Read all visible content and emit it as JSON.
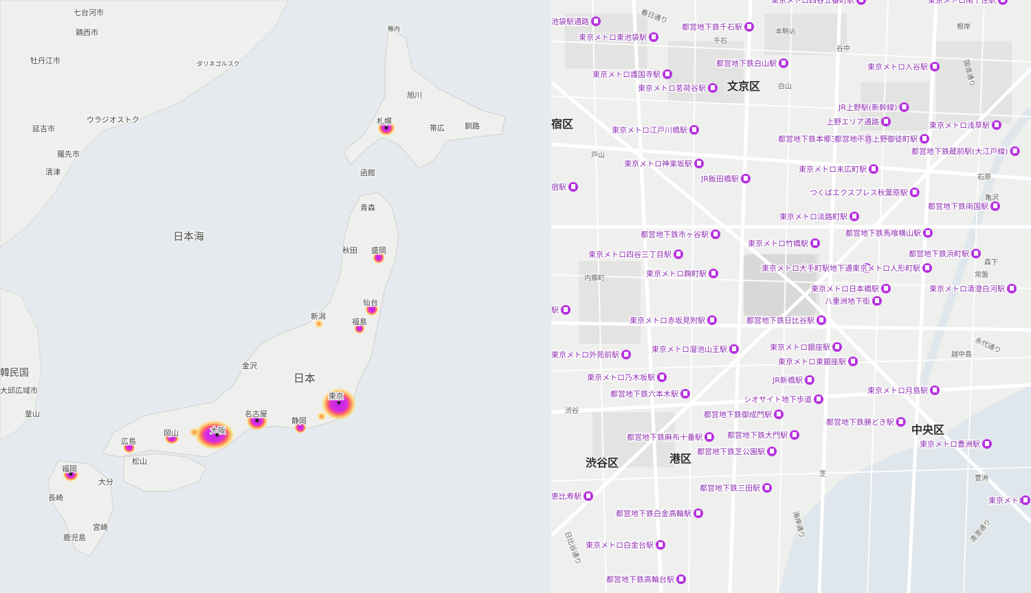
{
  "left_map": {
    "sea_labels": [
      "日本海"
    ],
    "country_labels": [
      "日本",
      "韓民国"
    ],
    "foreign_cities": [
      "七台河市",
      "鶏西市",
      "牡丹江市",
      "ダリネゴルスク",
      "ウラジオストク",
      "延吉市",
      "羅先市",
      "清津",
      "大邱広域市",
      "釜山"
    ],
    "cities": [
      "稚内",
      "旭川",
      "札幌",
      "帯広",
      "釧路",
      "函館",
      "青森",
      "秋田",
      "盛岡",
      "仙台",
      "新潟",
      "福島",
      "金沢",
      "名古屋",
      "静岡",
      "東京",
      "大阪",
      "岡山",
      "広島",
      "松山",
      "福岡",
      "大分",
      "長崎",
      "宮崎",
      "鹿児島"
    ],
    "hotspots": [
      {
        "city": "東京",
        "intensity": 1.0
      },
      {
        "city": "大阪",
        "intensity": 0.95
      },
      {
        "city": "名古屋",
        "intensity": 0.7
      },
      {
        "city": "札幌",
        "intensity": 0.6
      },
      {
        "city": "福岡",
        "intensity": 0.55
      },
      {
        "city": "仙台",
        "intensity": 0.5
      },
      {
        "city": "広島",
        "intensity": 0.45
      },
      {
        "city": "岡山",
        "intensity": 0.45
      },
      {
        "city": "静岡",
        "intensity": 0.4
      },
      {
        "city": "盛岡",
        "intensity": 0.35
      },
      {
        "city": "福島",
        "intensity": 0.35
      },
      {
        "city": "新潟",
        "intensity": 0.25
      }
    ]
  },
  "right_map": {
    "wards": [
      "文京区",
      "宿区",
      "渋谷区",
      "港区",
      "中央区"
    ],
    "areas": [
      "本駒込",
      "千石",
      "谷中",
      "白山",
      "根岸",
      "戸山",
      "石原",
      "亀沢",
      "森下",
      "内藤町",
      "常盤",
      "越中島",
      "渋谷",
      "豊洲",
      "芝"
    ],
    "roads": [
      "春日通り",
      "国道通り",
      "永代通り",
      "海岸通り",
      "清澄通り",
      "日比谷通り"
    ],
    "stations": [
      "東京メトロ四谷五番町駅",
      "東京メトロ南千住駅",
      "池袋駅通路",
      "都営地下鉄千石駅",
      "東京メトロ東池袋駅",
      "都営地下鉄白山駅",
      "東京メトロ入谷駅",
      "東京メトロ護国寺駅",
      "東京メトロ茗荷谷駅",
      "JR上野駅(新幹線)",
      "上野エリア通路",
      "東京メトロ浅草駅",
      "東京メトロ江戸川橋駅",
      "都営地下鉄本郷三丁目駅",
      "都営地下鉄上野御徒町駅",
      "都営地下鉄蔵前駅(大江戸線)",
      "東京メトロ神楽坂駅",
      "東京メトロ末広町駅",
      "JR飯田橋駅",
      "宿駅",
      "つくばエクスプレス秋葉原駅",
      "都営地下鉄両国駅",
      "東京メトロ淡路町駅",
      "都営地下鉄市ヶ谷駅",
      "都営地下鉄馬喰横山駅",
      "東京メトロ竹橋駅",
      "都営地下鉄浜町駅",
      "東京メトロ四谷三丁目駅",
      "東京メトロ大手町駅地下通路",
      "東京メトロ人形町駅",
      "東京メトロ麹町駅",
      "東京メトロ日本橋駅",
      "東京メトロ清澄白河駅",
      "八重洲地下街",
      "駅",
      "東京メトロ赤坂見附駅",
      "都営地下鉄日比谷駅",
      "東京メトロ溜池山王駅",
      "東京メトロ銀座駅",
      "東京メトロ外苑前駅",
      "東京メトロ東銀座駅",
      "東京メトロ乃木坂駅",
      "JR新橋駅",
      "都営地下鉄六本木駅",
      "シオサイト地下歩道",
      "東京メトロ月島駅",
      "都営地下鉄御成門駅",
      "都営地下鉄勝どき駅",
      "都営地下鉄麻布十番駅",
      "都営地下鉄大門駅",
      "東京メトロ豊洲駅",
      "都営地下鉄芝公園駅",
      "都営地下鉄三田駅",
      "恵比寿駅",
      "東京メトロ",
      "都営地下鉄白金高輪駅",
      "東京メトロ白金台駅",
      "都営地下鉄高輪台駅"
    ]
  },
  "colors": {
    "sea": "#e5eaee",
    "land": "#f1f1ef",
    "road": "#ffffff",
    "station": "#b631e0",
    "heat_core": "#c21fe8",
    "heat_mid": "#ff5a5a",
    "heat_edge": "#ffd34d"
  }
}
